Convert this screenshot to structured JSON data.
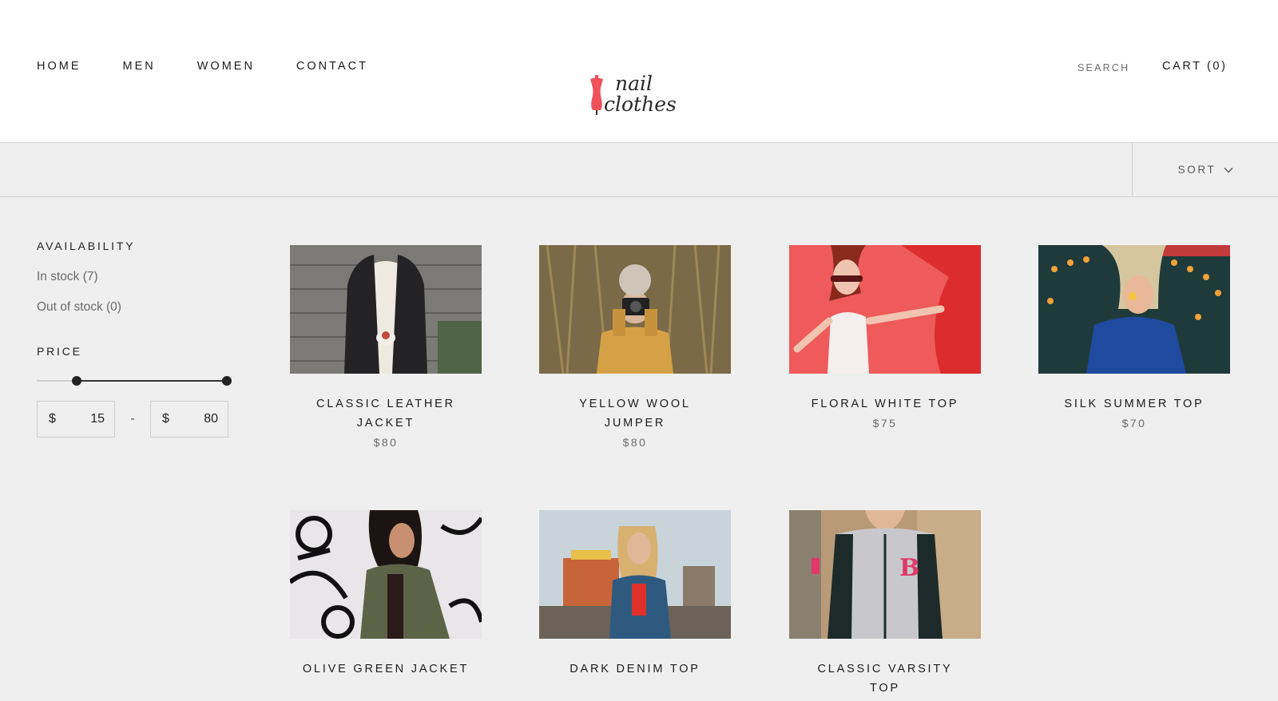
{
  "nav": {
    "items": [
      {
        "label": "HOME"
      },
      {
        "label": "MEN"
      },
      {
        "label": "WOMEN"
      },
      {
        "label": "CONTACT"
      }
    ]
  },
  "logo": {
    "line1": "nail",
    "line2": "clothes",
    "accent_color": "#f0505a"
  },
  "header": {
    "search_label": "SEARCH",
    "cart_label": "CART (0)"
  },
  "toolbar": {
    "sort_label": "SORT"
  },
  "filters": {
    "availability_title": "AVAILABILITY",
    "availability_options": [
      {
        "label": "In stock (7)"
      },
      {
        "label": "Out of stock (0)"
      }
    ],
    "price_title": "PRICE",
    "currency": "$",
    "min_value": "15",
    "max_value": "80",
    "separator": "-"
  },
  "products": [
    {
      "name": "CLASSIC LEATHER JACKET",
      "price": "$80"
    },
    {
      "name": "YELLOW WOOL JUMPER",
      "price": "$80"
    },
    {
      "name": "FLORAL WHITE TOP",
      "price": "$75"
    },
    {
      "name": "SILK SUMMER TOP",
      "price": "$70"
    },
    {
      "name": "OLIVE GREEN JACKET",
      "price": ""
    },
    {
      "name": "DARK DENIM TOP",
      "price": ""
    },
    {
      "name": "CLASSIC VARSITY TOP",
      "price": ""
    }
  ]
}
